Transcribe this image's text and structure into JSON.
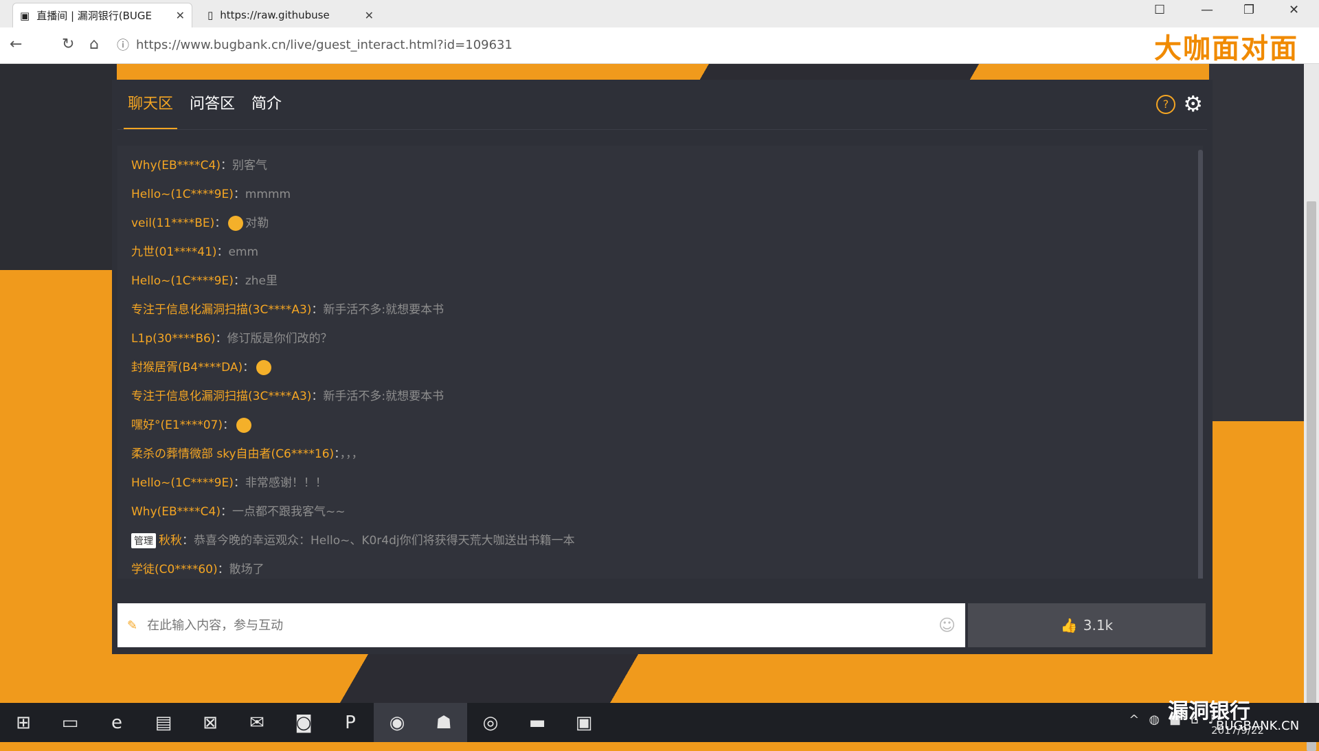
{
  "browser": {
    "tabs": [
      {
        "title": "直播间 | 漏洞银行(BUGE",
        "close": "✕"
      },
      {
        "title": "https://raw.githubuse",
        "close": "✕"
      }
    ],
    "url": "https://www.bugbank.cn/live/guest_interact.html?id=109631",
    "banner": "大咖面对面"
  },
  "panel": {
    "tabs": [
      "聊天区",
      "问答区",
      "简介"
    ],
    "help_icon": "?",
    "gear_icon": "⚙"
  },
  "chat": [
    {
      "user": "Why(EB****C4)",
      "text": "别客气"
    },
    {
      "user": "Hello~(1C****9E)",
      "text": "mmmm"
    },
    {
      "user": "veil(11****BE)",
      "text": "对勒"
    },
    {
      "user": "九世(01****41)",
      "text": "emm"
    },
    {
      "user": "Hello~(1C****9E)",
      "text": "zhe里"
    },
    {
      "user": "专注于信息化漏洞扫描(3C****A3)",
      "text": "新手活不多:就想要本书"
    },
    {
      "user": "L1p(30****B6)",
      "text": "修订版是你们改的？"
    },
    {
      "user": "封猴居胥(B4****DA)",
      "text": ""
    },
    {
      "user": "专注于信息化漏洞扫描(3C****A3)",
      "text": "新手活不多:就想要本书"
    },
    {
      "user": "嘿好°(E1****07)",
      "text": ""
    },
    {
      "user": "柔杀の葬情微部 sky自由者(C6****16)",
      "text": "，，，"
    },
    {
      "user": "Hello~(1C****9E)",
      "text": "非常感谢！！！"
    },
    {
      "user": "Why(EB****C4)",
      "text": "一点都不跟我客气~~"
    },
    {
      "user": "秋秋",
      "badge": "管理",
      "text": "恭喜今晚的幸运观众：Hello~、K0r4dj你们将获得天荒大咖送出书籍一本"
    },
    {
      "user": "学徒(C0****60)",
      "text": "散场了"
    }
  ],
  "chat_sep": "：",
  "input": {
    "placeholder": "在此输入内容，参与互动"
  },
  "like": {
    "icon": "👍",
    "count": "3.1k"
  },
  "logo": {
    "title": "漏洞银行",
    "sub": "BUGBANK.CN"
  },
  "taskbar": {
    "clock": "2017/9/22"
  }
}
